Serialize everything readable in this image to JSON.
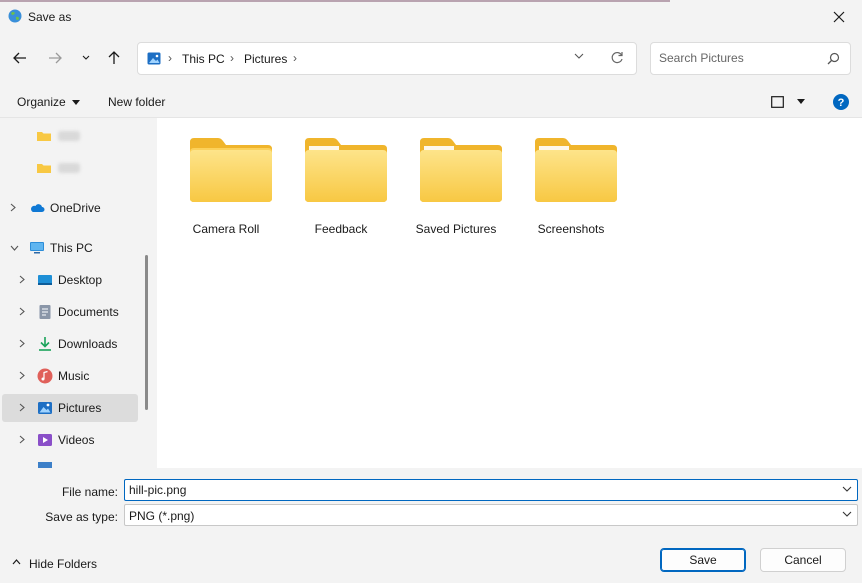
{
  "window": {
    "title": "Save as"
  },
  "nav": {
    "breadcrumb": [
      "This PC",
      "Pictures"
    ],
    "search_placeholder": "Search Pictures"
  },
  "commands": {
    "organize": "Organize",
    "new_folder": "New folder"
  },
  "sidebar": {
    "items": [
      {
        "label": "OneDrive",
        "icon": "onedrive-icon"
      },
      {
        "label": "This PC",
        "icon": "computer-icon"
      },
      {
        "label": "Desktop",
        "icon": "desktop-icon"
      },
      {
        "label": "Documents",
        "icon": "documents-icon"
      },
      {
        "label": "Downloads",
        "icon": "downloads-icon"
      },
      {
        "label": "Music",
        "icon": "music-icon"
      },
      {
        "label": "Pictures",
        "icon": "pictures-icon",
        "selected": true
      },
      {
        "label": "Videos",
        "icon": "videos-icon"
      }
    ]
  },
  "folders": [
    {
      "label": "Camera Roll"
    },
    {
      "label": "Feedback"
    },
    {
      "label": "Saved Pictures"
    },
    {
      "label": "Screenshots"
    }
  ],
  "form": {
    "file_name_label": "File name:",
    "file_name_value": "hill-pic.png",
    "save_type_label": "Save as type:",
    "save_type_value": "PNG (*.png)"
  },
  "footer": {
    "hide_folders": "Hide Folders",
    "save": "Save",
    "cancel": "Cancel"
  },
  "colors": {
    "accent": "#0067c0",
    "folder": "#f8c843",
    "selected": "#dcdcdc"
  }
}
